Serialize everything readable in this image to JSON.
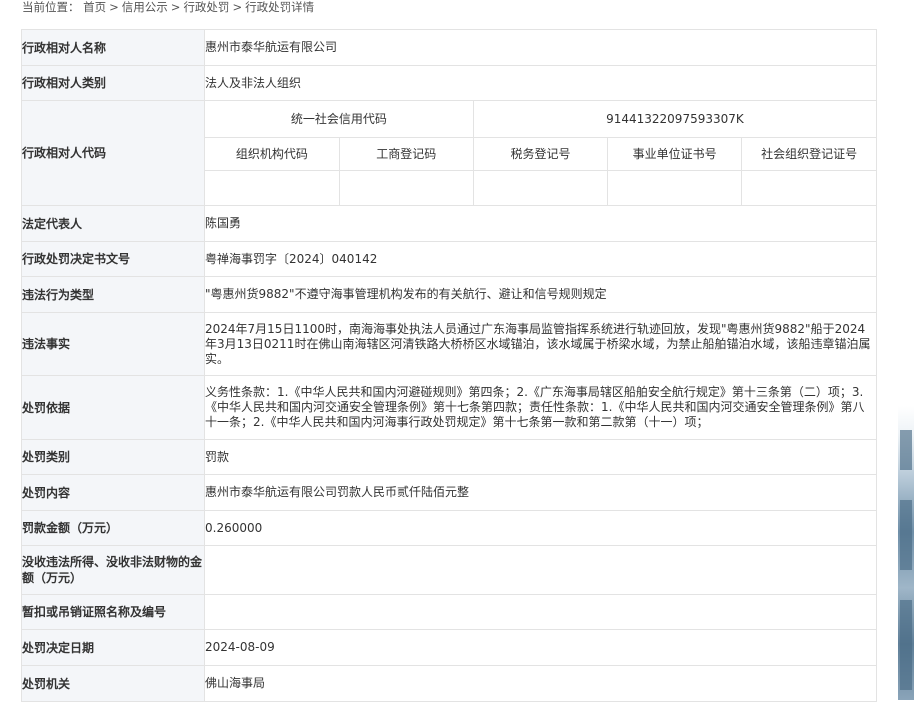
{
  "breadcrumb": {
    "label": "当前位置：",
    "items": [
      "首页",
      "信用公示",
      "行政处罚",
      "行政处罚详情"
    ],
    "separator": ">"
  },
  "rows": {
    "name": {
      "label": "行政相对人名称",
      "value": "惠州市泰华航运有限公司"
    },
    "category": {
      "label": "行政相对人类别",
      "value": "法人及非法人组织"
    },
    "code": {
      "label": "行政相对人代码",
      "credit_code_label": "统一社会信用代码",
      "credit_code_value": "91441322097593307K",
      "headers": [
        "组织机构代码",
        "工商登记码",
        "税务登记号",
        "事业单位证书号",
        "社会组织登记证号"
      ],
      "values": [
        "",
        "",
        "",
        "",
        ""
      ]
    },
    "legal_rep": {
      "label": "法定代表人",
      "value": "陈国勇"
    },
    "decision_no": {
      "label": "行政处罚决定书文号",
      "value": "粤禅海事罚字〔2024〕040142"
    },
    "violation_type": {
      "label": "违法行为类型",
      "value": "\"粤惠州货9882\"不遵守海事管理机构发布的有关航行、避让和信号规则规定"
    },
    "violation_fact": {
      "label": "违法事实",
      "value": "2024年7月15日1100时，南海海事处执法人员通过广东海事局监管指挥系统进行轨迹回放，发现\"粤惠州货9882\"船于2024年3月13日0211时在佛山南海辖区河清铁路大桥桥区水域锚泊，该水域属于桥梁水域，为禁止船舶锚泊水域，该船违章锚泊属实。"
    },
    "basis": {
      "label": "处罚依据",
      "value": "义务性条款：1.《中华人民共和国内河避碰规则》第四条；2.《广东海事局辖区船舶安全航行规定》第十三条第（二）项；3.《中华人民共和国内河交通安全管理条例》第十七条第四款；责任性条款：1.《中华人民共和国内河交通安全管理条例》第八十一条；2.《中华人民共和国内河海事行政处罚规定》第十七条第一款和第二款第（十一）项；"
    },
    "penalty_type": {
      "label": "处罚类别",
      "value": "罚款"
    },
    "penalty_content": {
      "label": "处罚内容",
      "value": "惠州市泰华航运有限公司罚款人民币贰仟陆佰元整"
    },
    "fine_amount": {
      "label": "罚款金额（万元）",
      "value": "0.260000"
    },
    "confiscation": {
      "label": "没收违法所得、没收非法财物的金额（万元）",
      "value": ""
    },
    "license": {
      "label": "暂扣或吊销证照名称及编号",
      "value": ""
    },
    "decision_date": {
      "label": "处罚决定日期",
      "value": "2024-08-09"
    },
    "authority": {
      "label": "处罚机关",
      "value": "佛山海事局"
    }
  }
}
